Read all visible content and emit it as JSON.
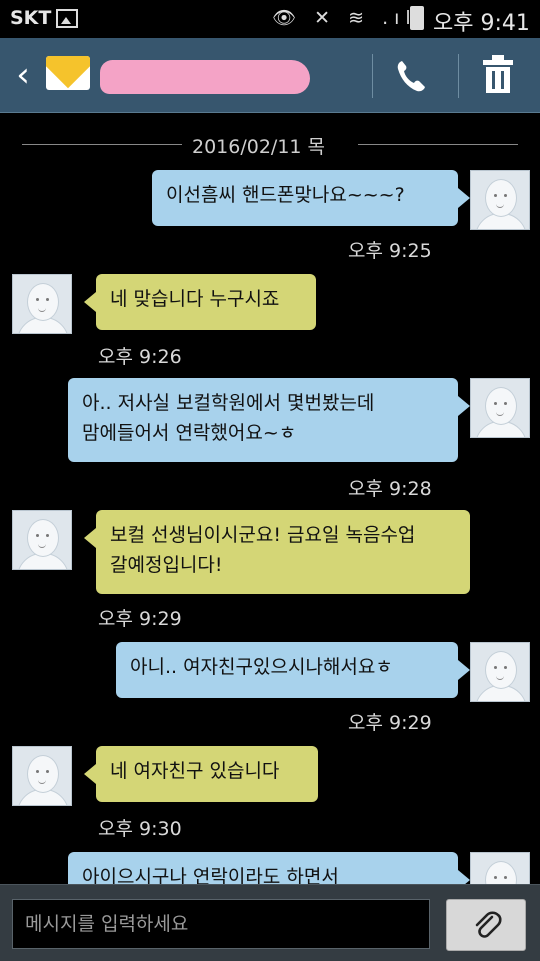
{
  "status_bar": {
    "carrier": "SKT",
    "status_icons": "👁 ✕ ≋ .ıl",
    "time": "오후 9:41"
  },
  "header": {
    "back_icon": "‹",
    "contact_name": "",
    "call_icon": "phone-icon",
    "delete_icon": "trash-icon",
    "envelope_color": "#f5c32c",
    "redaction_color": "#f4a3c6"
  },
  "conversation": {
    "date": "2016/02/11 목",
    "messages": [
      {
        "direction": "out",
        "text": "이선흠씨 핸드폰맞나요~~~?",
        "time": "오후 9:25"
      },
      {
        "direction": "in",
        "text": "네 맞습니다 누구시죠",
        "time": "오후 9:26"
      },
      {
        "direction": "out",
        "line1": "아.. 저사실 보컬학원에서 몇번봤는데",
        "line2": "맘에들어서 연락했어요~ㅎ",
        "time": "오후 9:28"
      },
      {
        "direction": "in",
        "line1": "보컬 선생님이시군요! 금요일 녹음수업",
        "line2": "갈예정입니다!",
        "time": "오후 9:29"
      },
      {
        "direction": "out",
        "text": "아니.. 여자친구있으시나해서요ㅎ",
        "time": "오후 9:29"
      },
      {
        "direction": "in",
        "text": "네 여자친구 있습니다",
        "time": "오후 9:30"
      },
      {
        "direction": "out",
        "text": "아이으시구나 연락이라도 하면서",
        "time": ""
      }
    ]
  },
  "composer": {
    "placeholder": "메시지를 입력하세요",
    "attach_icon": "paperclip-icon"
  },
  "colors": {
    "outgoing_bubble": "#a8d2ec",
    "incoming_bubble": "#d4d676",
    "header": "#37566e"
  }
}
